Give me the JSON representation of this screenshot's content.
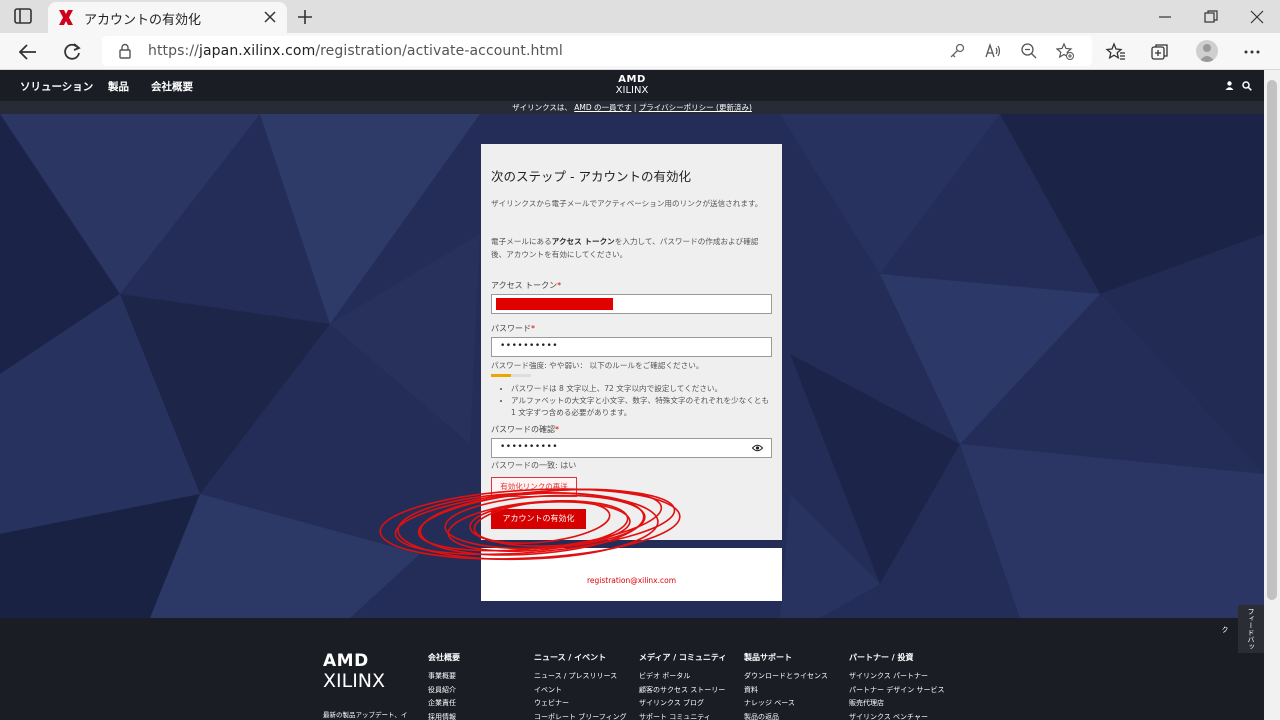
{
  "browser": {
    "tab_title": "アカウントの有効化",
    "url_prefix": "https://",
    "url_host": "japan.xilinx.com",
    "url_path": "/registration/activate-account.html"
  },
  "site": {
    "nav": [
      "ソリューション",
      "製品",
      "会社概要"
    ],
    "logo_amd": "AMD",
    "logo_xilinx": "XILINX",
    "notice_prefix": "ザイリンクスは、",
    "notice_link1": "AMD の一員です",
    "notice_sep": " | ",
    "notice_link2": "プライバシーポリシー (更新済み)"
  },
  "form": {
    "heading": "次のステップ - アカウントの有効化",
    "intro": "ザイリンクスから電子メールでアクティベーション用のリンクが送信されます。",
    "instr_prefix": "電子メールにある",
    "instr_bold": "アクセス トークン",
    "instr_suffix": "を入力して、パスワードの作成および確認後、アカウントを有効にしてください。",
    "token_label": "アクセス トークン",
    "password_label": "パスワード",
    "password_value": "••••••••••",
    "strength_text": "パスワード強度: やや弱い： 以下のルールをご確認ください。",
    "strength_level": 0.5,
    "rules": [
      "パスワードは 8 文字以上、72 文字以内で設定してください。",
      "アルファベットの大文字と小文字、数字、特殊文字のそれぞれを少なくとも 1 文字ずつ含める必要があります。"
    ],
    "confirm_label": "パスワードの確認",
    "confirm_value": "••••••••••",
    "match_text": "パスワードの一致: はい",
    "resend_button": "有効化リンクの再送",
    "activate_button": "アカウントの有効化",
    "email": "registration@xilinx.com",
    "required_mark": "*"
  },
  "footer": {
    "logo_amd": "AMD",
    "logo_xilinx": "XILINX",
    "news_text": "最新の製品アップデート、イ",
    "columns": [
      {
        "heading": "会社概要",
        "items": [
          "事業概要",
          "役員紹介",
          "企業責任",
          "採用情報"
        ]
      },
      {
        "heading": "ニュース / イベント",
        "items": [
          "ニュース / プレスリリース",
          "イベント",
          "ウェビナー",
          "コーポレート ブリーフィング"
        ]
      },
      {
        "heading": "メディア / コミュニティ",
        "items": [
          "ビデオ ポータル",
          "顧客のサクセス ストーリー",
          "ザイリンクス ブログ",
          "サポート コミュニティ"
        ]
      },
      {
        "heading": "製品サポート",
        "items": [
          "ダウンロードとライセンス",
          "資料",
          "ナレッジ ベース",
          "製品の返品"
        ]
      },
      {
        "heading": "パートナー / 投資",
        "items": [
          "ザイリンクス パートナー",
          "パートナー デザイン サービス",
          "販売代理店",
          "ザイリンクス ベンチャー"
        ]
      }
    ],
    "feedback": "フィードバック"
  }
}
